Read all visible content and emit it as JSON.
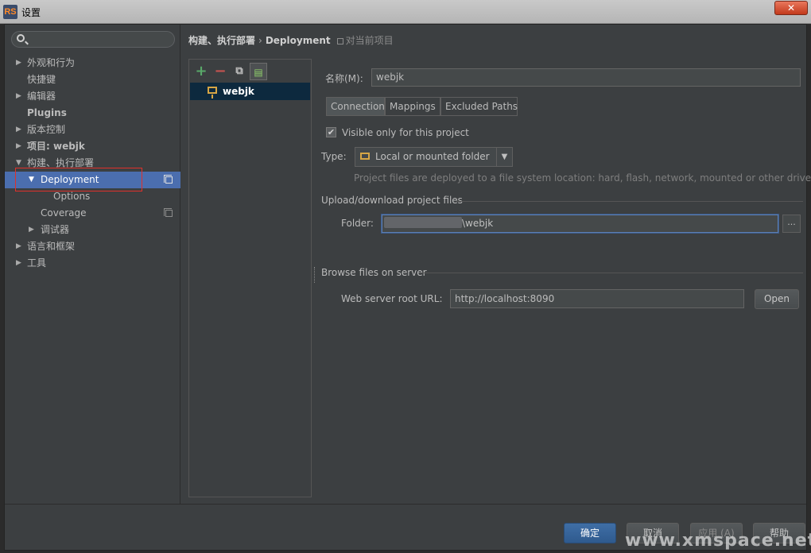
{
  "window": {
    "title": "设置",
    "app_icon": "RS",
    "close_label": "✕"
  },
  "search": {
    "placeholder": ""
  },
  "sidebar": {
    "items": [
      {
        "label": "外观和行为"
      },
      {
        "label": "快捷键"
      },
      {
        "label": "编辑器"
      },
      {
        "label": "Plugins"
      },
      {
        "label": "版本控制"
      },
      {
        "label": "项目: webjk"
      },
      {
        "label": "构建、执行部署"
      },
      {
        "label": "Deployment"
      },
      {
        "label": "Options"
      },
      {
        "label": "Coverage"
      },
      {
        "label": "调试器"
      },
      {
        "label": "语言和框架"
      },
      {
        "label": "工具"
      }
    ]
  },
  "breadcrumb": {
    "parent": "构建、执行部署",
    "separator": "›",
    "current": "Deployment",
    "scope": "对当前项目"
  },
  "server_list": {
    "servers": [
      {
        "name": "webjk"
      }
    ]
  },
  "form": {
    "name_label": "名称(M):",
    "name_value": "webjk",
    "tabs": [
      {
        "label": "Connection",
        "active": true
      },
      {
        "label": "Mappings"
      },
      {
        "label": "Excluded Paths"
      }
    ],
    "visible_only_label": "Visible only for this project",
    "visible_only_checked": "✔",
    "type_label": "Type:",
    "type_value": "Local or mounted folder",
    "type_hint": "Project files are deployed to a file system location: hard, flash, network, mounted or other drive.",
    "upload_section": "Upload/download project files",
    "folder_label": "Folder:",
    "folder_value": "\\webjk",
    "browse_label": "...",
    "browse_section": "Browse files on server",
    "web_root_label": "Web server root URL:",
    "web_root_value": "http://localhost:8090",
    "open_label": "Open"
  },
  "footer": {
    "ok": "确定",
    "cancel": "取消",
    "apply": "应用 (A)",
    "help": "帮助"
  },
  "watermark": "www.xmspace.net"
}
